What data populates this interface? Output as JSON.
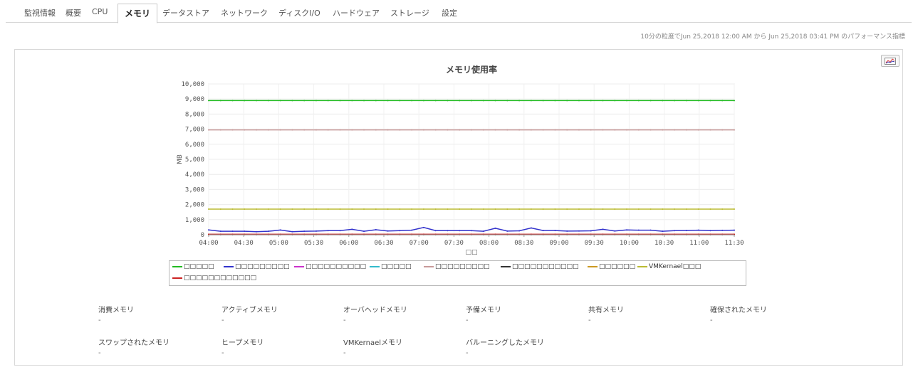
{
  "tabs": [
    {
      "label": "監視情報",
      "active": false
    },
    {
      "label": "概要",
      "active": false
    },
    {
      "label": "CPU",
      "active": false
    },
    {
      "label": "メモリ",
      "active": true
    },
    {
      "label": "データストア",
      "active": false
    },
    {
      "label": "ネットワーク",
      "active": false
    },
    {
      "label": "ディスクI/O",
      "active": false
    },
    {
      "label": "ハードウェア",
      "active": false
    },
    {
      "label": "ストレージ",
      "active": false
    },
    {
      "label": "設定",
      "active": false
    }
  ],
  "period_text": "10分の粒度でJun 25,2018 12:00 AM から Jun 25,2018 03:41 PM のパフォーマンス指標",
  "export_icon": "chart-export-icon",
  "chart_data": {
    "type": "line",
    "title": "メモリ使用率",
    "ylabel": "MB",
    "xlabel": "□□",
    "ylim": [
      0,
      10000
    ],
    "yticks": [
      "0",
      "1,000",
      "2,000",
      "3,000",
      "4,000",
      "5,000",
      "6,000",
      "7,000",
      "8,000",
      "9,000",
      "10,000"
    ],
    "x": [
      "04:00",
      "04:30",
      "05:00",
      "05:30",
      "06:00",
      "06:30",
      "07:00",
      "07:30",
      "08:00",
      "08:30",
      "09:00",
      "09:30",
      "10:00",
      "10:30",
      "11:00",
      "11:30"
    ],
    "grid": true,
    "legend_position": "bottom",
    "series": [
      {
        "name": "□□□□□",
        "color": "#22bb22",
        "values": [
          8900,
          8900,
          8900,
          8900,
          8900,
          8900,
          8900,
          8900,
          8900,
          8900,
          8900,
          8900,
          8900,
          8900,
          8900,
          8900
        ]
      },
      {
        "name": "□□□□□□□□□",
        "color": "#3333cc",
        "values": [
          260,
          200,
          250,
          200,
          280,
          250,
          260,
          230,
          250,
          260,
          240,
          230,
          240,
          250,
          260,
          270
        ]
      },
      {
        "name": "□□□□□□□□□□",
        "color": "#cc33cc",
        "values": [
          20,
          20,
          20,
          20,
          20,
          20,
          20,
          20,
          20,
          20,
          20,
          20,
          20,
          20,
          20,
          20
        ]
      },
      {
        "name": "□□□□□",
        "color": "#33bbcc",
        "values": [
          10,
          10,
          10,
          10,
          10,
          10,
          10,
          10,
          10,
          10,
          10,
          10,
          10,
          10,
          10,
          10
        ]
      },
      {
        "name": "□□□□□□□□□",
        "color": "#c89a9a",
        "values": [
          6950,
          6950,
          6950,
          6950,
          6950,
          6950,
          6950,
          6950,
          6950,
          6950,
          6950,
          6950,
          6950,
          6950,
          6950,
          6950
        ]
      },
      {
        "name": "□□□□□□□□□□□",
        "color": "#333333",
        "values": [
          5,
          5,
          5,
          5,
          5,
          5,
          5,
          5,
          5,
          5,
          5,
          5,
          5,
          5,
          5,
          5
        ]
      },
      {
        "name": "□□□□□□",
        "color": "#cc9922",
        "values": [
          15,
          15,
          15,
          15,
          15,
          15,
          15,
          15,
          15,
          15,
          15,
          15,
          15,
          15,
          15,
          15
        ]
      },
      {
        "name": "VMKernael□□□",
        "color": "#bbbb33",
        "values": [
          1700,
          1700,
          1700,
          1700,
          1700,
          1700,
          1700,
          1700,
          1700,
          1700,
          1700,
          1700,
          1700,
          1700,
          1700,
          1700
        ]
      },
      {
        "name": "□□□□□□□□□□□□",
        "color": "#cc2222",
        "values": [
          30,
          30,
          30,
          30,
          30,
          30,
          30,
          30,
          30,
          30,
          30,
          30,
          30,
          30,
          30,
          30
        ]
      }
    ],
    "purple_detail": [
      320,
      230,
      230,
      230,
      200,
      230,
      310,
      200,
      230,
      240,
      270,
      270,
      360,
      230,
      330,
      250,
      270,
      300,
      480,
      270,
      270,
      270,
      270,
      230,
      430,
      240,
      260,
      450,
      280,
      280,
      240,
      250,
      260,
      360,
      250,
      320,
      300,
      300,
      230,
      270,
      280,
      300,
      270,
      290,
      300
    ]
  },
  "metrics": [
    {
      "label": "消費メモリ",
      "value": "-"
    },
    {
      "label": "アクティブメモリ",
      "value": "-"
    },
    {
      "label": "オーバヘッドメモリ",
      "value": "-"
    },
    {
      "label": "予備メモリ",
      "value": "-"
    },
    {
      "label": "共有メモリ",
      "value": "-"
    },
    {
      "label": "確保されたメモリ",
      "value": "-"
    },
    {
      "label": "スワップされたメモリ",
      "value": "-"
    },
    {
      "label": "ヒープメモリ",
      "value": "-"
    },
    {
      "label": "VMKernaelメモリ",
      "value": "-"
    },
    {
      "label": "バルーニングしたメモリ",
      "value": "-"
    }
  ]
}
